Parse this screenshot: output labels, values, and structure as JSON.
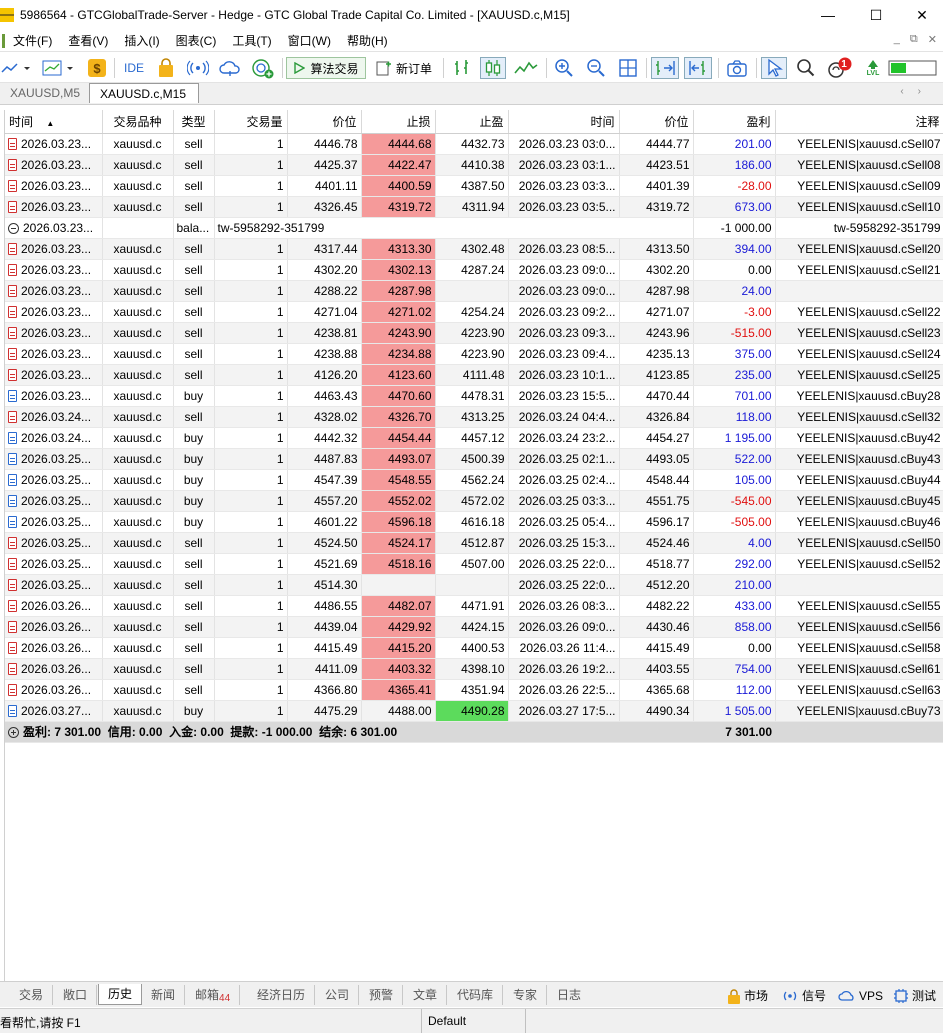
{
  "window": {
    "title": "5986564 - GTCGlobalTrade-Server - Hedge - GTC Global Trade Capital Co. Limited - [XAUUSD.c,M15]",
    "controls": [
      "—",
      "☐",
      "✕"
    ]
  },
  "menu": {
    "items": [
      "文件(F)",
      "查看(V)",
      "插入(I)",
      "图表(C)",
      "工具(T)",
      "窗口(W)",
      "帮助(H)"
    ],
    "mdi_controls": [
      "_",
      "⧉",
      "✕"
    ]
  },
  "toolbar": {
    "ide_label": "IDE",
    "algo_label": "算法交易",
    "new_order_label": "新订单",
    "notification_count": "1",
    "lvl_label": "LVL"
  },
  "chart_tabs": [
    {
      "label": "XAUUSD,M5",
      "active": false
    },
    {
      "label": "XAUUSD.c,M15",
      "active": true
    }
  ],
  "table": {
    "columns": [
      "时间",
      "交易品种",
      "类型",
      "交易量",
      "价位",
      "止损",
      "止盈",
      "时间",
      "价位",
      "盈利",
      "注释"
    ],
    "rows": [
      {
        "kind": "sell",
        "t1": "2026.03.23...",
        "sym": "xauusd.c",
        "type": "sell",
        "vol": "1",
        "p1": "4446.78",
        "sl": "4444.68",
        "sl_hit": true,
        "tp": "4432.73",
        "tp_hit": false,
        "t2": "2026.03.23 03:0...",
        "p2": "4444.77",
        "profit": "201.00",
        "sign": "pos",
        "comment": "YEELENIS|xauusd.cSell07"
      },
      {
        "kind": "sell",
        "t1": "2026.03.23...",
        "sym": "xauusd.c",
        "type": "sell",
        "vol": "1",
        "p1": "4425.37",
        "sl": "4422.47",
        "sl_hit": true,
        "tp": "4410.38",
        "tp_hit": false,
        "t2": "2026.03.23 03:1...",
        "p2": "4423.51",
        "profit": "186.00",
        "sign": "pos",
        "comment": "YEELENIS|xauusd.cSell08"
      },
      {
        "kind": "sell",
        "t1": "2026.03.23...",
        "sym": "xauusd.c",
        "type": "sell",
        "vol": "1",
        "p1": "4401.11",
        "sl": "4400.59",
        "sl_hit": true,
        "tp": "4387.50",
        "tp_hit": false,
        "t2": "2026.03.23 03:3...",
        "p2": "4401.39",
        "profit": "-28.00",
        "sign": "neg",
        "comment": "YEELENIS|xauusd.cSell09"
      },
      {
        "kind": "sell",
        "t1": "2026.03.23...",
        "sym": "xauusd.c",
        "type": "sell",
        "vol": "1",
        "p1": "4326.45",
        "sl": "4319.72",
        "sl_hit": true,
        "tp": "4311.94",
        "tp_hit": false,
        "t2": "2026.03.23 03:5...",
        "p2": "4319.72",
        "profit": "673.00",
        "sign": "pos",
        "comment": "YEELENIS|xauusd.cSell10"
      },
      {
        "kind": "balance",
        "t1": "2026.03.23...",
        "sym": "",
        "type": "bala...",
        "detail": "tw-5958292-351799",
        "profit": "-1 000.00",
        "sign": "none",
        "comment": "tw-5958292-351799"
      },
      {
        "kind": "sell",
        "t1": "2026.03.23...",
        "sym": "xauusd.c",
        "type": "sell",
        "vol": "1",
        "p1": "4317.44",
        "sl": "4313.30",
        "sl_hit": true,
        "tp": "4302.48",
        "tp_hit": false,
        "t2": "2026.03.23 08:5...",
        "p2": "4313.50",
        "profit": "394.00",
        "sign": "pos",
        "comment": "YEELENIS|xauusd.cSell20"
      },
      {
        "kind": "sell",
        "t1": "2026.03.23...",
        "sym": "xauusd.c",
        "type": "sell",
        "vol": "1",
        "p1": "4302.20",
        "sl": "4302.13",
        "sl_hit": true,
        "tp": "4287.24",
        "tp_hit": false,
        "t2": "2026.03.23 09:0...",
        "p2": "4302.20",
        "profit": "0.00",
        "sign": "zero",
        "comment": "YEELENIS|xauusd.cSell21"
      },
      {
        "kind": "sell",
        "t1": "2026.03.23...",
        "sym": "xauusd.c",
        "type": "sell",
        "vol": "1",
        "p1": "4288.22",
        "sl": "4287.98",
        "sl_hit": true,
        "tp": "",
        "tp_hit": false,
        "t2": "2026.03.23 09:0...",
        "p2": "4287.98",
        "profit": "24.00",
        "sign": "pos",
        "comment": ""
      },
      {
        "kind": "sell",
        "t1": "2026.03.23...",
        "sym": "xauusd.c",
        "type": "sell",
        "vol": "1",
        "p1": "4271.04",
        "sl": "4271.02",
        "sl_hit": true,
        "tp": "4254.24",
        "tp_hit": false,
        "t2": "2026.03.23 09:2...",
        "p2": "4271.07",
        "profit": "-3.00",
        "sign": "neg",
        "comment": "YEELENIS|xauusd.cSell22"
      },
      {
        "kind": "sell",
        "t1": "2026.03.23...",
        "sym": "xauusd.c",
        "type": "sell",
        "vol": "1",
        "p1": "4238.81",
        "sl": "4243.90",
        "sl_hit": true,
        "tp": "4223.90",
        "tp_hit": false,
        "t2": "2026.03.23 09:3...",
        "p2": "4243.96",
        "profit": "-515.00",
        "sign": "neg",
        "comment": "YEELENIS|xauusd.cSell23"
      },
      {
        "kind": "sell",
        "t1": "2026.03.23...",
        "sym": "xauusd.c",
        "type": "sell",
        "vol": "1",
        "p1": "4238.88",
        "sl": "4234.88",
        "sl_hit": true,
        "tp": "4223.90",
        "tp_hit": false,
        "t2": "2026.03.23 09:4...",
        "p2": "4235.13",
        "profit": "375.00",
        "sign": "pos",
        "comment": "YEELENIS|xauusd.cSell24"
      },
      {
        "kind": "sell",
        "t1": "2026.03.23...",
        "sym": "xauusd.c",
        "type": "sell",
        "vol": "1",
        "p1": "4126.20",
        "sl": "4123.60",
        "sl_hit": true,
        "tp": "4111.48",
        "tp_hit": false,
        "t2": "2026.03.23 10:1...",
        "p2": "4123.85",
        "profit": "235.00",
        "sign": "pos",
        "comment": "YEELENIS|xauusd.cSell25"
      },
      {
        "kind": "buy",
        "t1": "2026.03.23...",
        "sym": "xauusd.c",
        "type": "buy",
        "vol": "1",
        "p1": "4463.43",
        "sl": "4470.60",
        "sl_hit": true,
        "tp": "4478.31",
        "tp_hit": false,
        "t2": "2026.03.23 15:5...",
        "p2": "4470.44",
        "profit": "701.00",
        "sign": "pos",
        "comment": "YEELENIS|xauusd.cBuy28"
      },
      {
        "kind": "sell",
        "t1": "2026.03.24...",
        "sym": "xauusd.c",
        "type": "sell",
        "vol": "1",
        "p1": "4328.02",
        "sl": "4326.70",
        "sl_hit": true,
        "tp": "4313.25",
        "tp_hit": false,
        "t2": "2026.03.24 04:4...",
        "p2": "4326.84",
        "profit": "118.00",
        "sign": "pos",
        "comment": "YEELENIS|xauusd.cSell32"
      },
      {
        "kind": "buy",
        "t1": "2026.03.24...",
        "sym": "xauusd.c",
        "type": "buy",
        "vol": "1",
        "p1": "4442.32",
        "sl": "4454.44",
        "sl_hit": true,
        "tp": "4457.12",
        "tp_hit": false,
        "t2": "2026.03.24 23:2...",
        "p2": "4454.27",
        "profit": "1 195.00",
        "sign": "pos",
        "comment": "YEELENIS|xauusd.cBuy42"
      },
      {
        "kind": "buy",
        "t1": "2026.03.25...",
        "sym": "xauusd.c",
        "type": "buy",
        "vol": "1",
        "p1": "4487.83",
        "sl": "4493.07",
        "sl_hit": true,
        "tp": "4500.39",
        "tp_hit": false,
        "t2": "2026.03.25 02:1...",
        "p2": "4493.05",
        "profit": "522.00",
        "sign": "pos",
        "comment": "YEELENIS|xauusd.cBuy43"
      },
      {
        "kind": "buy",
        "t1": "2026.03.25...",
        "sym": "xauusd.c",
        "type": "buy",
        "vol": "1",
        "p1": "4547.39",
        "sl": "4548.55",
        "sl_hit": true,
        "tp": "4562.24",
        "tp_hit": false,
        "t2": "2026.03.25 02:4...",
        "p2": "4548.44",
        "profit": "105.00",
        "sign": "pos",
        "comment": "YEELENIS|xauusd.cBuy44"
      },
      {
        "kind": "buy",
        "t1": "2026.03.25...",
        "sym": "xauusd.c",
        "type": "buy",
        "vol": "1",
        "p1": "4557.20",
        "sl": "4552.02",
        "sl_hit": true,
        "tp": "4572.02",
        "tp_hit": false,
        "t2": "2026.03.25 03:3...",
        "p2": "4551.75",
        "profit": "-545.00",
        "sign": "neg",
        "comment": "YEELENIS|xauusd.cBuy45"
      },
      {
        "kind": "buy",
        "t1": "2026.03.25...",
        "sym": "xauusd.c",
        "type": "buy",
        "vol": "1",
        "p1": "4601.22",
        "sl": "4596.18",
        "sl_hit": true,
        "tp": "4616.18",
        "tp_hit": false,
        "t2": "2026.03.25 05:4...",
        "p2": "4596.17",
        "profit": "-505.00",
        "sign": "neg",
        "comment": "YEELENIS|xauusd.cBuy46"
      },
      {
        "kind": "sell",
        "t1": "2026.03.25...",
        "sym": "xauusd.c",
        "type": "sell",
        "vol": "1",
        "p1": "4524.50",
        "sl": "4524.17",
        "sl_hit": true,
        "tp": "4512.87",
        "tp_hit": false,
        "t2": "2026.03.25 15:3...",
        "p2": "4524.46",
        "profit": "4.00",
        "sign": "pos",
        "comment": "YEELENIS|xauusd.cSell50"
      },
      {
        "kind": "sell",
        "t1": "2026.03.25...",
        "sym": "xauusd.c",
        "type": "sell",
        "vol": "1",
        "p1": "4521.69",
        "sl": "4518.16",
        "sl_hit": true,
        "tp": "4507.00",
        "tp_hit": false,
        "t2": "2026.03.25 22:0...",
        "p2": "4518.77",
        "profit": "292.00",
        "sign": "pos",
        "comment": "YEELENIS|xauusd.cSell52"
      },
      {
        "kind": "sell",
        "t1": "2026.03.25...",
        "sym": "xauusd.c",
        "type": "sell",
        "vol": "1",
        "p1": "4514.30",
        "sl": "",
        "sl_hit": false,
        "tp": "",
        "tp_hit": false,
        "t2": "2026.03.25 22:0...",
        "p2": "4512.20",
        "profit": "210.00",
        "sign": "pos",
        "comment": ""
      },
      {
        "kind": "sell",
        "t1": "2026.03.26...",
        "sym": "xauusd.c",
        "type": "sell",
        "vol": "1",
        "p1": "4486.55",
        "sl": "4482.07",
        "sl_hit": true,
        "tp": "4471.91",
        "tp_hit": false,
        "t2": "2026.03.26 08:3...",
        "p2": "4482.22",
        "profit": "433.00",
        "sign": "pos",
        "comment": "YEELENIS|xauusd.cSell55"
      },
      {
        "kind": "sell",
        "t1": "2026.03.26...",
        "sym": "xauusd.c",
        "type": "sell",
        "vol": "1",
        "p1": "4439.04",
        "sl": "4429.92",
        "sl_hit": true,
        "tp": "4424.15",
        "tp_hit": false,
        "t2": "2026.03.26 09:0...",
        "p2": "4430.46",
        "profit": "858.00",
        "sign": "pos",
        "comment": "YEELENIS|xauusd.cSell56"
      },
      {
        "kind": "sell",
        "t1": "2026.03.26...",
        "sym": "xauusd.c",
        "type": "sell",
        "vol": "1",
        "p1": "4415.49",
        "sl": "4415.20",
        "sl_hit": true,
        "tp": "4400.53",
        "tp_hit": false,
        "t2": "2026.03.26 11:4...",
        "p2": "4415.49",
        "profit": "0.00",
        "sign": "zero",
        "comment": "YEELENIS|xauusd.cSell58"
      },
      {
        "kind": "sell",
        "t1": "2026.03.26...",
        "sym": "xauusd.c",
        "type": "sell",
        "vol": "1",
        "p1": "4411.09",
        "sl": "4403.32",
        "sl_hit": true,
        "tp": "4398.10",
        "tp_hit": false,
        "t2": "2026.03.26 19:2...",
        "p2": "4403.55",
        "profit": "754.00",
        "sign": "pos",
        "comment": "YEELENIS|xauusd.cSell61"
      },
      {
        "kind": "sell",
        "t1": "2026.03.26...",
        "sym": "xauusd.c",
        "type": "sell",
        "vol": "1",
        "p1": "4366.80",
        "sl": "4365.41",
        "sl_hit": true,
        "tp": "4351.94",
        "tp_hit": false,
        "t2": "2026.03.26 22:5...",
        "p2": "4365.68",
        "profit": "112.00",
        "sign": "pos",
        "comment": "YEELENIS|xauusd.cSell63"
      },
      {
        "kind": "buy",
        "t1": "2026.03.27...",
        "sym": "xauusd.c",
        "type": "buy",
        "vol": "1",
        "p1": "4475.29",
        "sl": "4488.00",
        "sl_hit": false,
        "tp": "4490.28",
        "tp_hit": true,
        "t2": "2026.03.27 17:5...",
        "p2": "4490.34",
        "profit": "1 505.00",
        "sign": "pos",
        "comment": "YEELENIS|xauusd.cBuy73"
      }
    ],
    "summary": {
      "text": "盈利: 7 301.00  信用: 0.00  入金: 0.00  提款: -1 000.00  结余: 6 301.00",
      "profit_total": "7 301.00"
    },
    "colors": {
      "positive": "#1a1ad6",
      "negative": "#e01010",
      "sl_highlight": "#f59a9a",
      "tp_highlight": "#5cdb5c"
    }
  },
  "bottom_tabs": [
    {
      "label": "交易",
      "badge": ""
    },
    {
      "label": "敞口",
      "badge": ""
    },
    {
      "label": "历史",
      "badge": "",
      "active": true
    },
    {
      "label": "新闻",
      "badge": ""
    },
    {
      "label": "邮箱",
      "badge": "44"
    },
    {
      "label": "经济日历",
      "badge": ""
    },
    {
      "label": "公司",
      "badge": ""
    },
    {
      "label": "预警",
      "badge": ""
    },
    {
      "label": "文章",
      "badge": ""
    },
    {
      "label": "代码库",
      "badge": ""
    },
    {
      "label": "专家",
      "badge": ""
    },
    {
      "label": "日志",
      "badge": ""
    }
  ],
  "bottom_right": {
    "market": "市场",
    "signals": "信号",
    "vps": "VPS",
    "tester": "测试"
  },
  "status": {
    "help": "看帮忙,请按 F1",
    "profile": "Default"
  }
}
